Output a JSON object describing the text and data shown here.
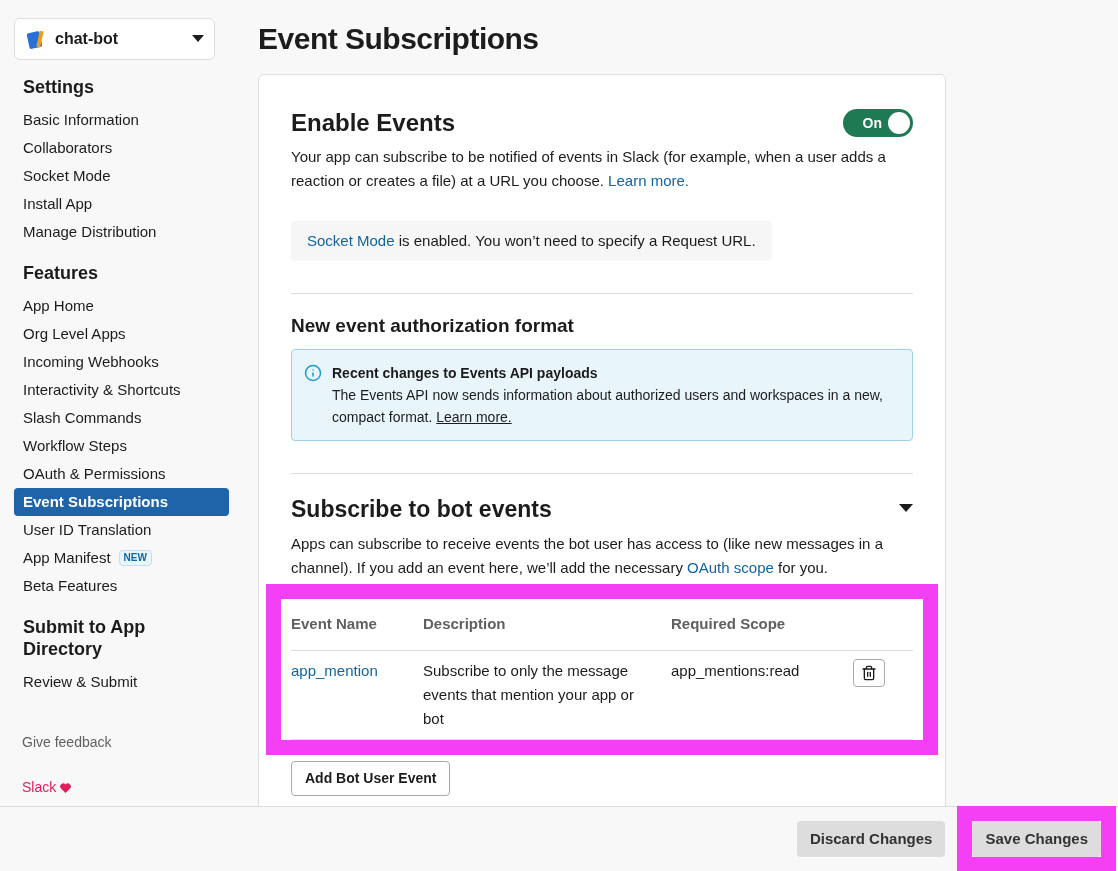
{
  "app": {
    "name": "chat-bot"
  },
  "sidebar": {
    "sections": [
      {
        "heading": "Settings",
        "items": [
          {
            "label": "Basic Information",
            "selected": false
          },
          {
            "label": "Collaborators",
            "selected": false
          },
          {
            "label": "Socket Mode",
            "selected": false
          },
          {
            "label": "Install App",
            "selected": false
          },
          {
            "label": "Manage Distribution",
            "selected": false
          }
        ]
      },
      {
        "heading": "Features",
        "items": [
          {
            "label": "App Home",
            "selected": false
          },
          {
            "label": "Org Level Apps",
            "selected": false
          },
          {
            "label": "Incoming Webhooks",
            "selected": false
          },
          {
            "label": "Interactivity & Shortcuts",
            "selected": false
          },
          {
            "label": "Slash Commands",
            "selected": false
          },
          {
            "label": "Workflow Steps",
            "selected": false
          },
          {
            "label": "OAuth & Permissions",
            "selected": false
          },
          {
            "label": "Event Subscriptions",
            "selected": true
          },
          {
            "label": "User ID Translation",
            "selected": false
          },
          {
            "label": "App Manifest",
            "selected": false,
            "badge": "NEW"
          },
          {
            "label": "Beta Features",
            "selected": false
          }
        ]
      },
      {
        "heading": "Submit to App Directory",
        "items": [
          {
            "label": "Review & Submit",
            "selected": false
          }
        ]
      }
    ],
    "feedback": "Give feedback",
    "brand": "Slack"
  },
  "page_title": "Event Subscriptions",
  "enable_events": {
    "title": "Enable Events",
    "toggle": {
      "label": "On",
      "on": true
    },
    "description": "Your app can subscribe to be notified of events in Slack (for example, when a user adds a reaction or creates a file) at a URL you choose.",
    "link": "Learn more."
  },
  "socket_notice": {
    "link": "Socket Mode",
    "text": "is enabled. You won’t need to specify a Request URL."
  },
  "auth_format": {
    "title": "New event authorization format",
    "callout": {
      "title": "Recent changes to Events API payloads",
      "text": "The Events API now sends information about authorized users and workspaces in a new, compact format.",
      "link": "Learn more."
    }
  },
  "bot_events": {
    "title": "Subscribe to bot events",
    "expanded": true,
    "description": "Apps can subscribe to receive events the bot user has access to (like new messages in a channel). If you add an event here, we’ll add the necessary",
    "link": "OAuth scope",
    "description_end": "for you.",
    "table": {
      "highlighted": true,
      "columns": [
        "Event Name",
        "Description",
        "Required Scope"
      ],
      "rows": [
        {
          "event": "app_mention",
          "description": "Subscribe to only the message events that mention your app or bot",
          "scope": "app_mentions:read"
        }
      ]
    },
    "add_button": "Add Bot User Event"
  },
  "footer": {
    "buttons": [
      {
        "label": "Discard Changes",
        "highlighted": false
      },
      {
        "label": "Save Changes",
        "highlighted": true
      }
    ]
  }
}
